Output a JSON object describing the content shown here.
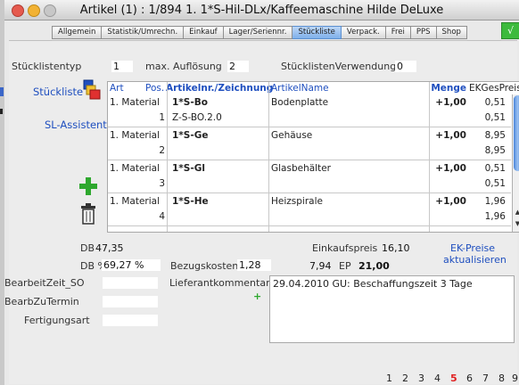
{
  "window": {
    "title": "Artikel (1) : 1/894 1.  1*S-Hil-DLx/Kaffeemaschine Hilde DeLuxe"
  },
  "tabs": [
    "Allgemein",
    "Statistik/Umrechn.",
    "Einkauf",
    "Lager/Seriennr.",
    "Stückliste",
    "Verpack.",
    "Frei",
    "PPS",
    "Shop"
  ],
  "active_tab": "Stückliste",
  "check_button": "√",
  "top": {
    "stuecklistentyp_label": "Stücklistentyp",
    "stuecklistentyp_value": "1",
    "max_aufloesung_label": "max. Auflösung",
    "max_aufloesung_value": "2",
    "verwendung_label": "StücklistenVerwendung",
    "verwendung_value": "0"
  },
  "links": {
    "stueckliste": "Stückliste",
    "sl_assistent": "SL-Assistent"
  },
  "grid": {
    "headers": {
      "art": "Art",
      "pos": "Pos.",
      "nr": "Artikelnr./Zeichnung",
      "name": "ArtikelName",
      "menge": "Menge",
      "ek": "EKGesPreis"
    },
    "rows": [
      {
        "art": "1. Material",
        "pos": "1",
        "nr": "1*S-Bo",
        "sub": "Z-S-BO.2.0",
        "name": "Bodenplatte",
        "menge": "+1,00",
        "ek1": "0,51",
        "ek2": "0,51"
      },
      {
        "art": "1. Material",
        "pos": "2",
        "nr": "1*S-Ge",
        "sub": "",
        "name": "Gehäuse",
        "menge": "+1,00",
        "ek1": "8,95",
        "ek2": "8,95"
      },
      {
        "art": "1. Material",
        "pos": "3",
        "nr": "1*S-Gl",
        "sub": "",
        "name": "Glasbehälter",
        "menge": "+1,00",
        "ek1": "0,51",
        "ek2": "0,51"
      },
      {
        "art": "1. Material",
        "pos": "4",
        "nr": "1*S-He",
        "sub": "",
        "name": "Heizspirale",
        "menge": "+1,00",
        "ek1": "1,96",
        "ek2": "1,96"
      }
    ]
  },
  "summary": {
    "db_label": "DB",
    "db_value": "47,35",
    "dbp_label": "DB %",
    "dbp_value": "69,27 %",
    "bezugskosten_label": "Bezugskosten",
    "bezugskosten_value": "1,28",
    "einkaufspreis_label": "Einkaufspreis",
    "einkaufspreis_value": "16,10",
    "ep_amount": "7,94",
    "ep_label": "EP",
    "ep_value": "21,00",
    "ek_link_line1": "EK-Preise",
    "ek_link_line2": "aktualisieren"
  },
  "fields": {
    "bearbeitzeit_label": "BearbeitZeit_SO",
    "bearbzutermin_label": "BearbZuTermin",
    "fertigungsart_label": "Fertigungsart",
    "lieferantkommentar_label": "Lieferantkommentar",
    "lieferantkommentar_value": "29.04.2010 GU: Beschaffungszeit 3 Tage",
    "add_plus": "+"
  },
  "pager": [
    "1",
    "2",
    "3",
    "4",
    "5",
    "6",
    "7",
    "8",
    "9"
  ],
  "pager_active": "5",
  "colors": {
    "accent_blue": "#1f4fbf",
    "active_page": "#e02020",
    "add_green": "#2ea82e"
  }
}
